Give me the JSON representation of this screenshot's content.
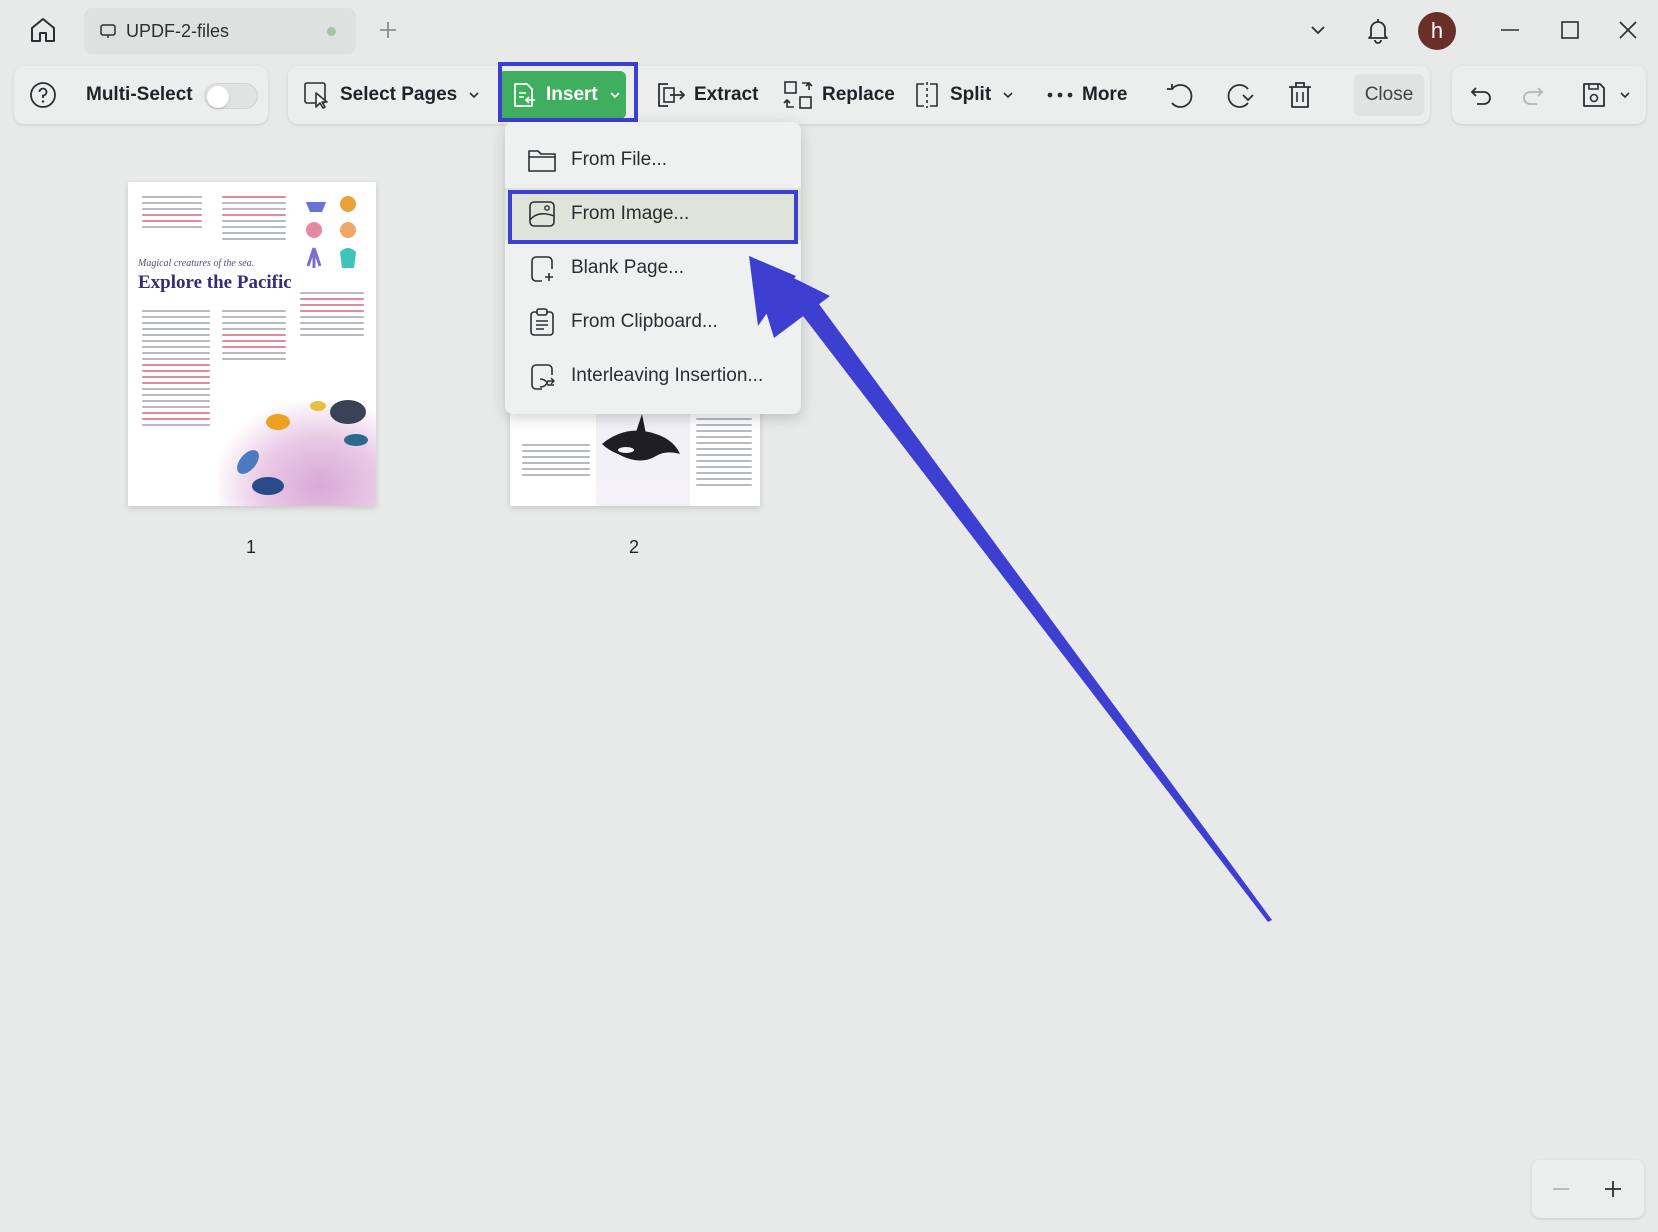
{
  "titlebar": {
    "tab_label": "UPDF-2-files",
    "avatar_initial": "h"
  },
  "toolbar": {
    "multi_select_label": "Multi-Select",
    "multi_select_on": false,
    "select_pages_label": "Select Pages",
    "insert_label": "Insert",
    "extract_label": "Extract",
    "replace_label": "Replace",
    "split_label": "Split",
    "more_label": "More",
    "close_label": "Close"
  },
  "insert_menu": {
    "items": [
      {
        "label": "From File...",
        "icon": "folder-icon"
      },
      {
        "label": "From Image...",
        "icon": "image-icon",
        "highlighted": true
      },
      {
        "label": "Blank Page...",
        "icon": "blank-page-icon"
      },
      {
        "label": "From Clipboard...",
        "icon": "clipboard-icon"
      },
      {
        "label": "Interleaving Insertion...",
        "icon": "interleave-icon"
      }
    ]
  },
  "pages": [
    {
      "number": "1",
      "subtitle": "Magical creatures of the sea.",
      "title": "Explore the Pacific"
    },
    {
      "number": "2"
    }
  ],
  "colors": {
    "accent_green": "#3fae5e",
    "annotation_blue": "#3d3fd0",
    "avatar": "#6b2f2a"
  }
}
